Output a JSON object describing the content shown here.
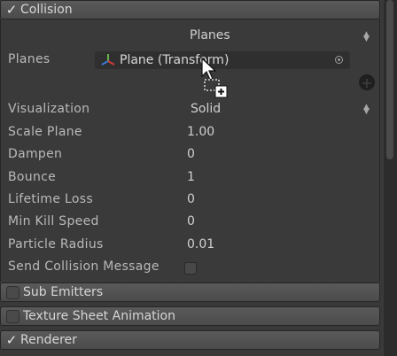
{
  "collision": {
    "header": "Collision",
    "planes_type": "Planes",
    "planes_label": "Planes",
    "plane_object": "Plane (Transform)",
    "visualization": {
      "label": "Visualization",
      "value": "Solid"
    },
    "scale_plane": {
      "label": "Scale Plane",
      "value": "1.00"
    },
    "dampen": {
      "label": "Dampen",
      "value": "0"
    },
    "bounce": {
      "label": "Bounce",
      "value": "1"
    },
    "lifetime_loss": {
      "label": "Lifetime Loss",
      "value": "0"
    },
    "min_kill_speed": {
      "label": "Min Kill Speed",
      "value": "0"
    },
    "particle_radius": {
      "label": "Particle Radius",
      "value": "0.01"
    },
    "send_collision_messages": {
      "label": "Send Collision Message"
    }
  },
  "modules": {
    "sub_emitters": "Sub Emitters",
    "texture_sheet_animation": "Texture Sheet Animation",
    "renderer": "Renderer"
  },
  "icons": {
    "collision_check": "check-icon",
    "object_icon": "transform-gizmo-icon",
    "object_picker": "target-picker-icon",
    "add_plane": "plus-circle-icon",
    "cursor": "drag-copy-cursor-icon"
  },
  "colors": {
    "panel_bg": "#393939",
    "header_bg": "#505050",
    "text": "#c8c8c8"
  }
}
